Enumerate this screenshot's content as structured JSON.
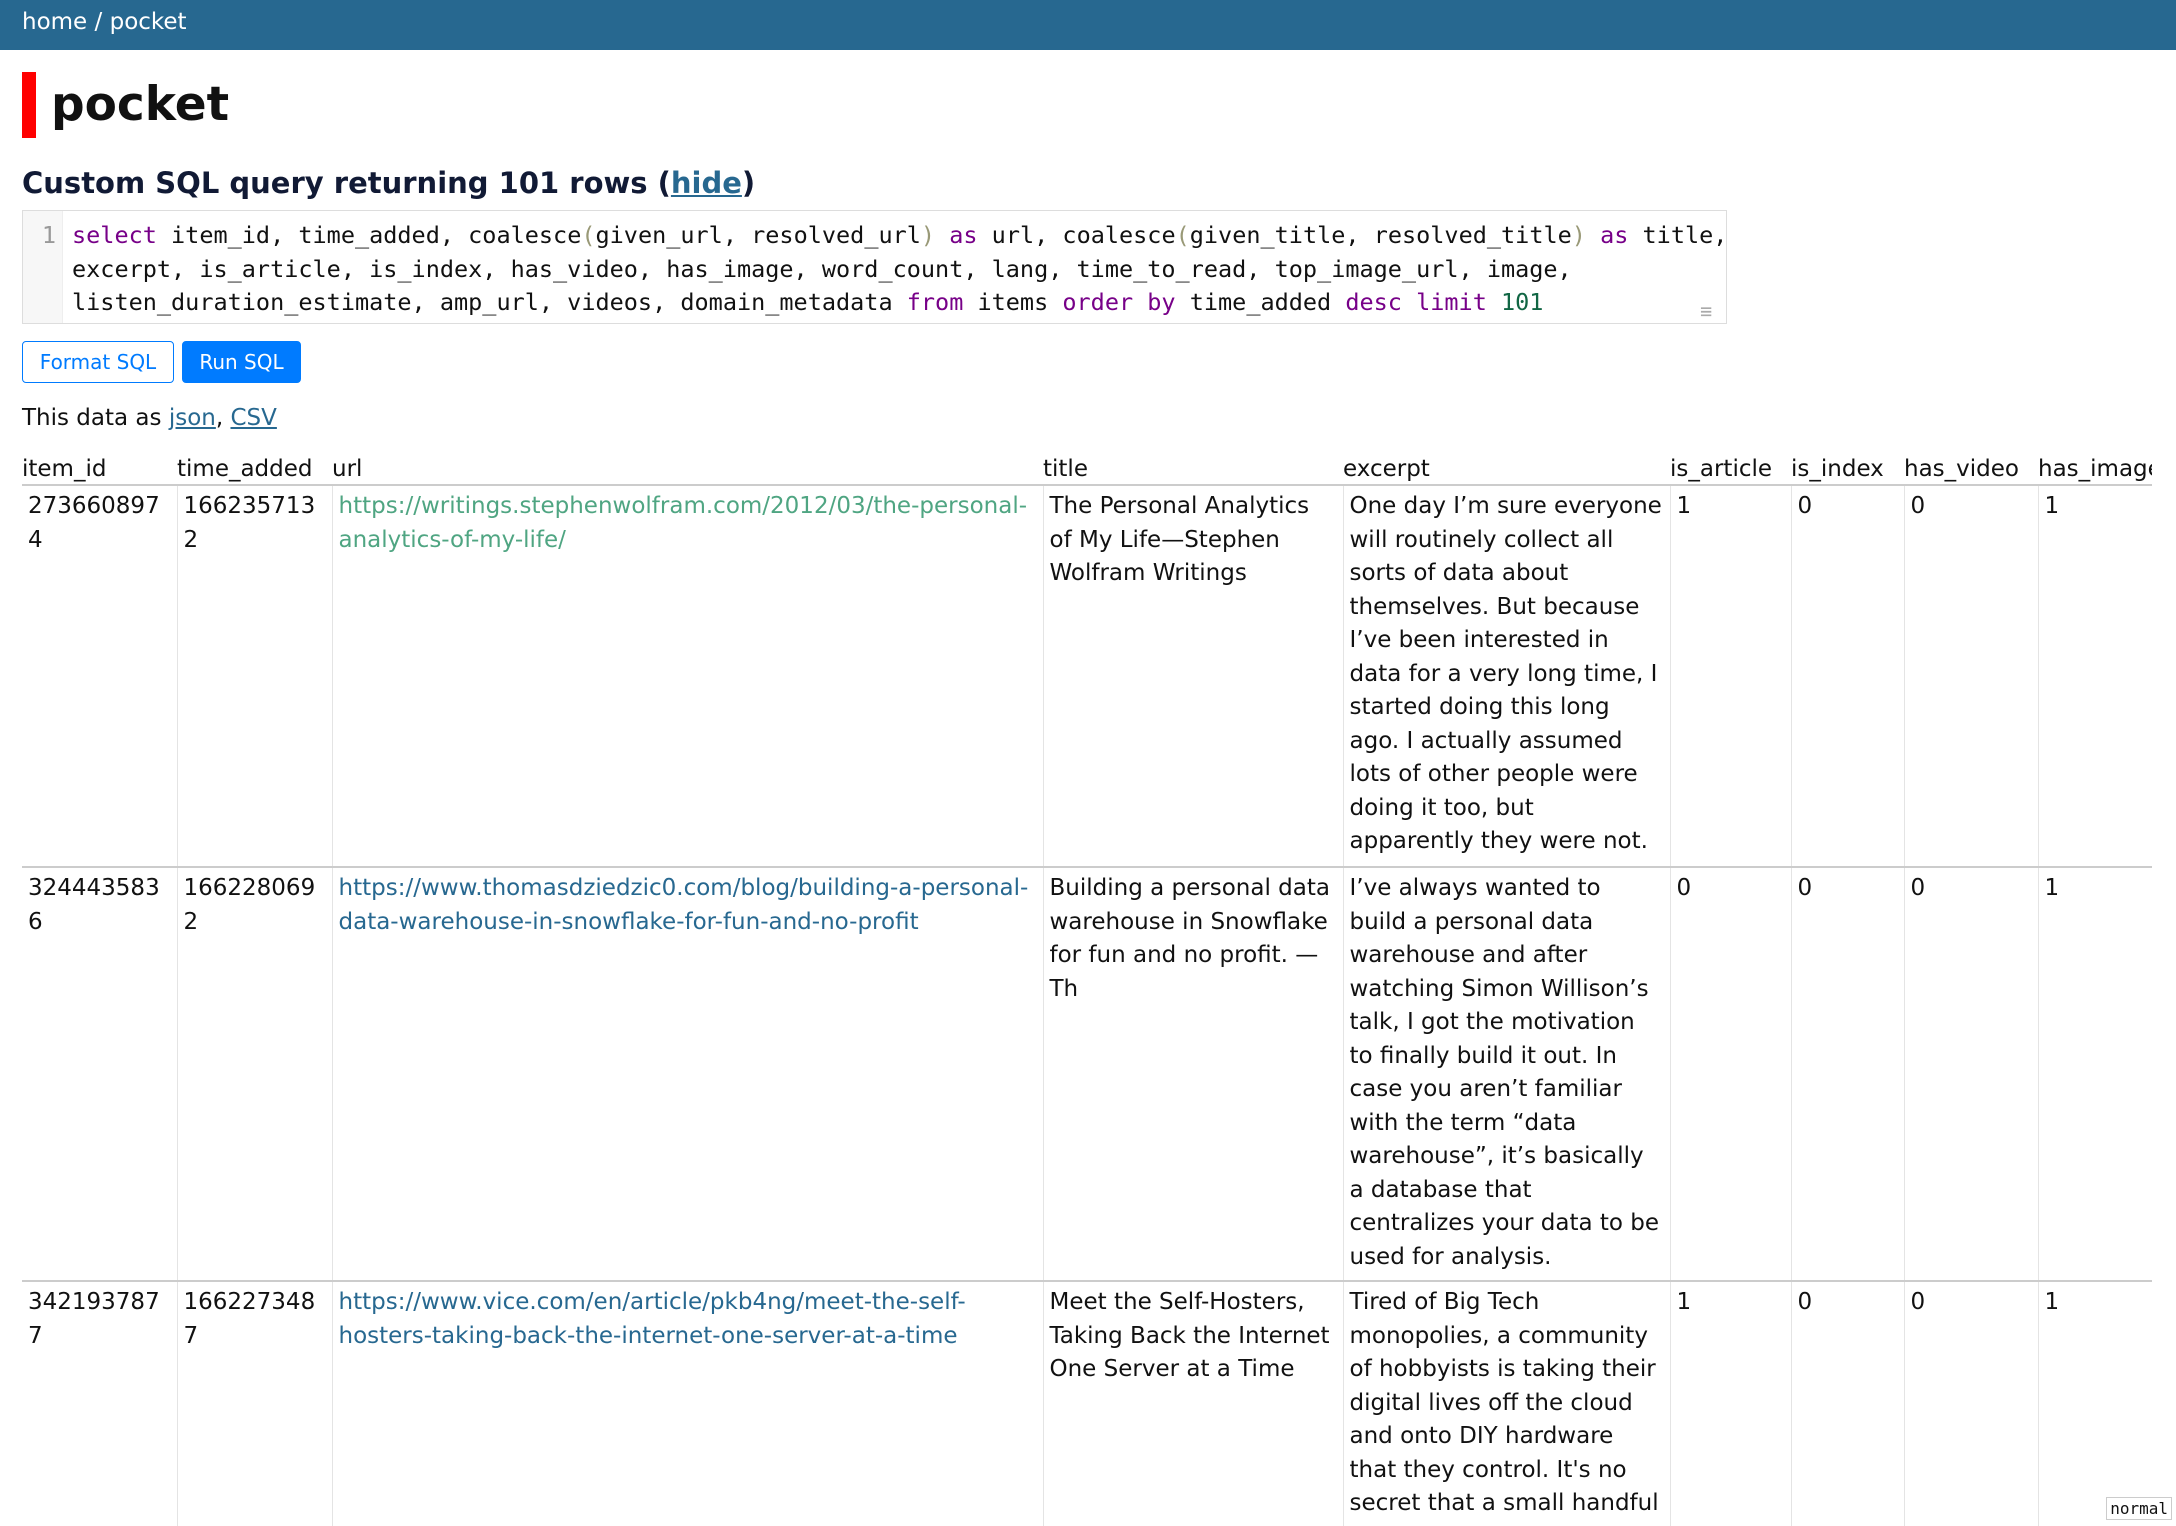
{
  "breadcrumb": {
    "home": "home",
    "separator": "/",
    "current": "pocket"
  },
  "page_title": "pocket",
  "query_heading": {
    "prefix": "Custom SQL query returning 101 rows (",
    "hide_link": "hide",
    "suffix": ")"
  },
  "sql": {
    "line_number": "1",
    "lines": [
      [
        [
          "kw",
          "select"
        ],
        [
          "t",
          " item_id, time_added, coalesce"
        ],
        [
          "p",
          "("
        ],
        [
          "t",
          "given_url, resolved_url"
        ],
        [
          "p",
          ")"
        ],
        [
          "t",
          " "
        ],
        [
          "kw",
          "as"
        ],
        [
          "t",
          " url, coalesce"
        ],
        [
          "p",
          "("
        ],
        [
          "t",
          "given_title, resolved_title"
        ],
        [
          "p",
          ")"
        ],
        [
          "t",
          " "
        ],
        [
          "kw",
          "as"
        ],
        [
          "t",
          " title,"
        ]
      ],
      [
        [
          "t",
          "excerpt, is_article, is_index, has_video, has_image, word_count, lang, time_to_read, top_image_url, image,"
        ]
      ],
      [
        [
          "t",
          "listen_duration_estimate, amp_url, videos, domain_metadata "
        ],
        [
          "kw",
          "from"
        ],
        [
          "t",
          " items "
        ],
        [
          "kw",
          "order by"
        ],
        [
          "t",
          " time_added "
        ],
        [
          "kw",
          "desc"
        ],
        [
          "t",
          " "
        ],
        [
          "kw",
          "limit"
        ],
        [
          "t",
          " "
        ],
        [
          "n",
          "101"
        ]
      ]
    ]
  },
  "buttons": {
    "format": "Format SQL",
    "run": "Run SQL"
  },
  "export": {
    "prefix": "This data as ",
    "json": "json",
    "sep": ", ",
    "csv": "CSV"
  },
  "table": {
    "columns": [
      "item_id",
      "time_added",
      "url",
      "title",
      "excerpt",
      "is_article",
      "is_index",
      "has_video",
      "has_image"
    ],
    "rows": [
      {
        "item_id": "2736608974",
        "time_added": "1662357132",
        "url": "https://writings.stephenwolfram.com/2012/03/the-personal-analytics-of-my-life/",
        "title": "The Personal Analytics of My Life—Stephen Wolfram Writings",
        "excerpt": "One day I’m sure everyone will routinely collect all sorts of data about themselves. But because I’ve been interested in data for a very long time, I started doing this long ago. I actually assumed lots of other people were doing it too, but apparently they were not.",
        "is_article": "1",
        "is_index": "0",
        "has_video": "0",
        "has_image": "1"
      },
      {
        "item_id": "3244435836",
        "time_added": "1662280692",
        "url": "https://www.thomasdziedzic0.com/blog/building-a-personal-data-warehouse-in-snowflake-for-fun-and-no-profit",
        "title": "Building a personal data warehouse in Snowflake for fun and no profit. — Th",
        "excerpt": "I’ve always wanted to build a personal data warehouse and after watching Simon Willison’s talk, I got the motivation to finally build it out. In case you aren’t familiar with the term “data warehouse”, it’s basically a database that centralizes your data to be used for analysis.",
        "is_article": "0",
        "is_index": "0",
        "has_video": "0",
        "has_image": "1"
      },
      {
        "item_id": "3421937877",
        "time_added": "1662273487",
        "url": "https://www.vice.com/en/article/pkb4ng/meet-the-self-hosters-taking-back-the-internet-one-server-at-a-time",
        "title": "Meet the Self-Hosters, Taking Back the Internet One Server at a Time",
        "excerpt": "Tired of Big Tech monopolies, a community of hobbyists is taking their digital lives off the cloud and onto DIY hardware that they control. It's no secret that a small handful of enormous companies",
        "is_article": "1",
        "is_index": "0",
        "has_video": "0",
        "has_image": "1"
      }
    ]
  },
  "mode_indicator": "normal"
}
